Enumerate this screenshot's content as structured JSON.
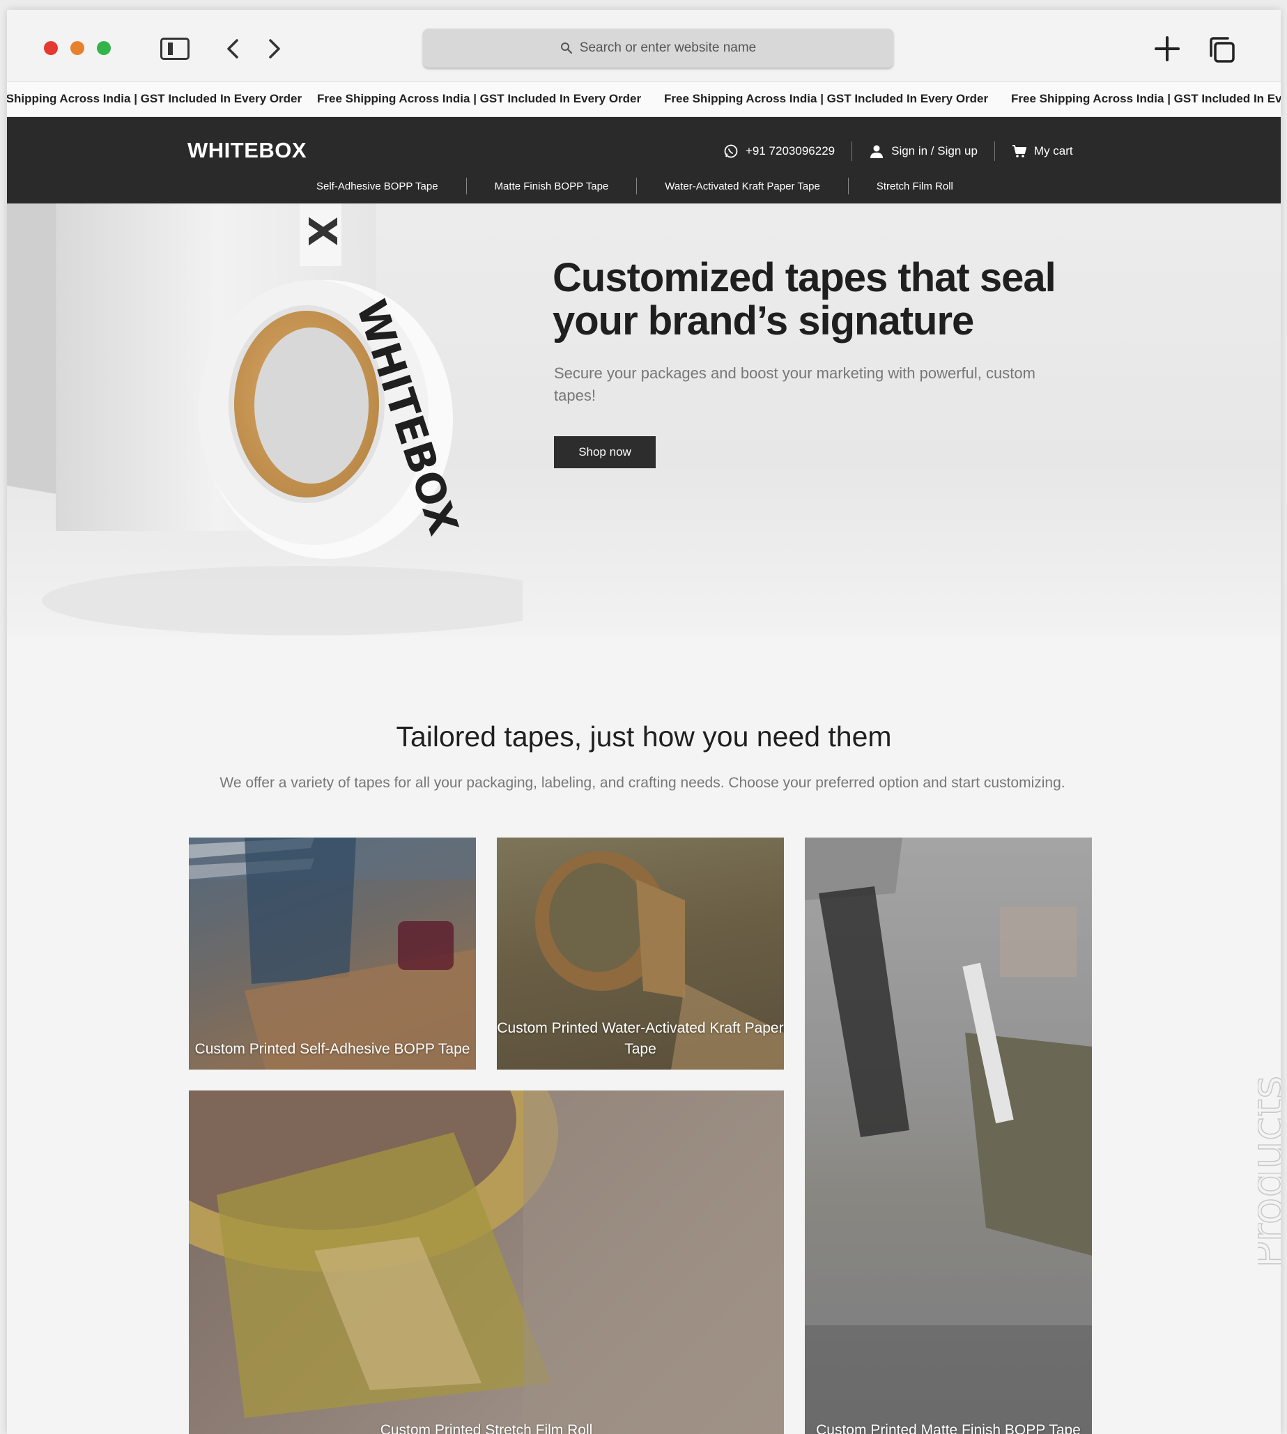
{
  "browser": {
    "address_placeholder": "Search or enter website name"
  },
  "promo": {
    "message": "Free Shipping Across India | GST Included In Every Order"
  },
  "header": {
    "logo": "WHITEBOX",
    "phone": "+91 7203096229",
    "sign_in": "Sign in / Sign up",
    "cart": "My cart"
  },
  "categories": [
    "Self-Adhesive BOPP Tape",
    "Matte Finish BOPP Tape",
    "Water-Activated Kraft Paper Tape",
    "Stretch Film Roll"
  ],
  "hero": {
    "title": "Customized tapes that seal your brand’s signature",
    "subtitle": "Secure your packages and boost your marketing with powerful, custom tapes!",
    "cta": "Shop now",
    "roll_print": "WHITEBOX",
    "box_print": "X"
  },
  "products": {
    "title": "Tailored tapes, just how you need them",
    "subtitle": "We offer a variety of tapes for all your packaging, labeling, and crafting needs. Choose your preferred option and start customizing.",
    "items": [
      "Custom Printed Self-Adhesive BOPP Tape",
      "Custom Printed Water-Activated Kraft Paper Tape",
      "Custom Printed Matte Finish BOPP Tape",
      "Custom Printed Stretch Film Roll"
    ]
  },
  "side_decor_text": "Products"
}
